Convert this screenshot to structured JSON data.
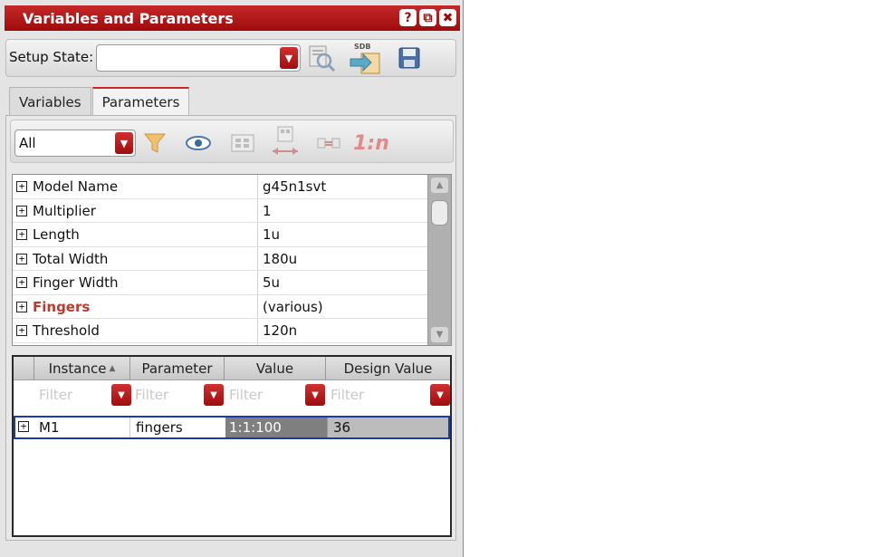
{
  "window": {
    "title": "Variables and Parameters",
    "help_glyph": "?",
    "float_glyph": "⧉",
    "close_glyph": "✖"
  },
  "setup": {
    "label": "Setup State:",
    "value": ""
  },
  "tabs": [
    {
      "label": "Variables"
    },
    {
      "label": "Parameters"
    }
  ],
  "parameters": {
    "filter_value": "All",
    "toolbar": {
      "one_to_n_label": "1:n"
    },
    "rows": [
      {
        "name": "Model Name",
        "value": "g45n1svt"
      },
      {
        "name": "Multiplier",
        "value": "1"
      },
      {
        "name": "Length",
        "value": "1u"
      },
      {
        "name": "Total Width",
        "value": "180u"
      },
      {
        "name": "Finger Width",
        "value": "5u"
      },
      {
        "name": "Fingers",
        "value": "(various)"
      },
      {
        "name": "Threshold",
        "value": "120n"
      }
    ]
  },
  "instances": {
    "columns": [
      "Instance",
      "Parameter",
      "Value",
      "Design Value"
    ],
    "sort_glyph": "▲",
    "filter_placeholder": "Filter",
    "rows": [
      {
        "instance": "M1",
        "parameter": "fingers",
        "value": "1:1:100",
        "design_value": "36"
      }
    ]
  },
  "colors": {
    "accent": "#c62828",
    "highlight_text": "#c0392b",
    "selection_border": "#1e3aa8"
  }
}
